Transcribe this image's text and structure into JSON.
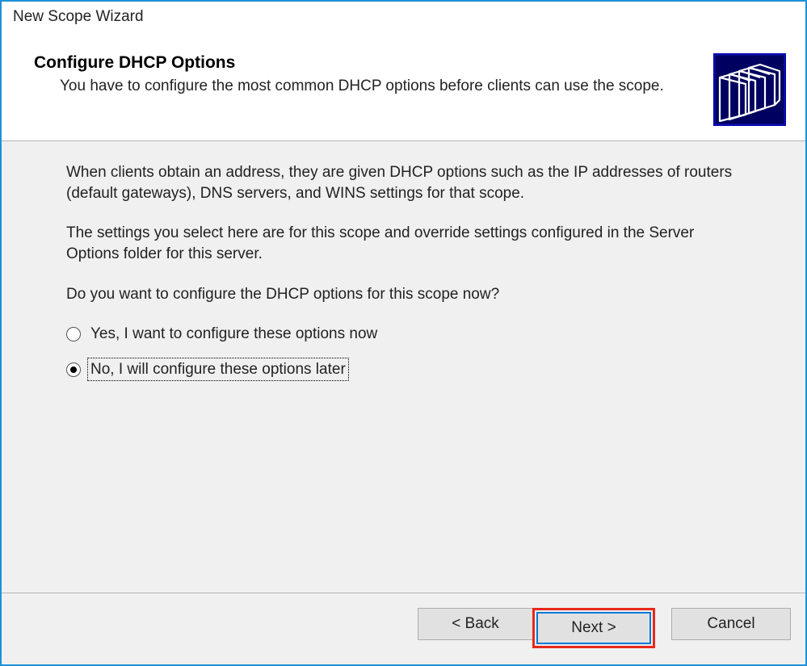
{
  "window": {
    "title": "New Scope Wizard"
  },
  "header": {
    "title": "Configure DHCP Options",
    "subtitle": "You have to configure the most common DHCP options before clients can use the scope."
  },
  "content": {
    "paragraph1": "When clients obtain an address, they are given DHCP options such as the IP addresses of routers (default gateways), DNS servers, and WINS settings for that scope.",
    "paragraph2": "The settings you select here are for this scope and override settings configured in the Server Options folder for this server.",
    "question": "Do you want to configure the DHCP options for this scope now?",
    "radios": {
      "yes": "Yes, I want to configure these options now",
      "no": "No, I will configure these options later"
    }
  },
  "footer": {
    "back": "< Back",
    "next": "Next >",
    "cancel": "Cancel"
  }
}
